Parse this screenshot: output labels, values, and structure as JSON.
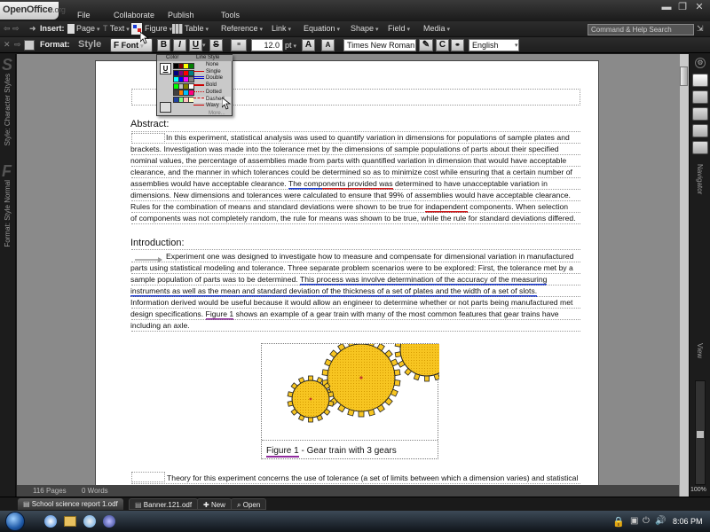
{
  "app": {
    "name": "OpenOffice",
    "name_suffix": ".org"
  },
  "menu": [
    "File",
    "Collaborate",
    "Publish",
    "Tools"
  ],
  "command_search_placeholder": "Command & Help Search",
  "toolbar_insert": {
    "label": "Insert:",
    "items": [
      "Page",
      "Text",
      "Figure",
      "Table",
      "Reference",
      "Link",
      "Equation",
      "Shape",
      "Field",
      "Media"
    ]
  },
  "toolbar_format": {
    "label": "Format:",
    "style_label": "Style",
    "font_label": "Font",
    "bold": "B",
    "italic": "I",
    "underline": "U",
    "strike": "S",
    "font_size": "12.0",
    "font_size_unit": "pt",
    "grow": "A",
    "shrink": "A",
    "font_name": "Times New Roman",
    "c_btn": "C",
    "language": "English"
  },
  "popup": {
    "color_header": "Color",
    "linestyle_header": "Line Style",
    "swatches": [
      "#000000",
      "#800000",
      "#ffff00",
      "#008000",
      "#000080",
      "#800080",
      "#ff0000",
      "#008080",
      "#00ffff",
      "#0000ff",
      "#ff00ff",
      "#808080",
      "#00ff00",
      "#c0c0c0",
      "#808000",
      "#ffffff",
      "#404040",
      "#ff8000",
      "#00c0ff",
      "#ff0080",
      "#2040a0",
      "#80ff80",
      "#ffc0c0",
      "#ffffc0"
    ],
    "styles": [
      "None",
      "Single",
      "Double",
      "Bold",
      "Dotted",
      "Dashed",
      "Wavy"
    ],
    "more": "More..."
  },
  "sidebar_left": {
    "char_styles": "Style: Character Styles",
    "format_style": "Format: Style Normal"
  },
  "sidebar_right": {
    "navigator": "Navigator",
    "view": "View",
    "zoom": "100%"
  },
  "document": {
    "abstract_heading": "Abstract:",
    "abstract_lines": [
      {
        "pre": "In this experiment, statistical analysis was used to quantify variation in dimensions for populations of sample plates and"
      },
      {
        "pre": "brackets.  Investigation was made into the tolerance met by the dimensions of sample populations of parts about their specified"
      },
      {
        "pre": "nominal values, the percentage of assemblies made from parts with quantified variation in dimension that would have acceptable"
      },
      {
        "pre": "clearance, and the manner in which tolerances could be determined so as to minimize cost while ensuring that a certain number of"
      },
      {
        "pre": "assemblies would have acceptable clearance.  ",
        "u1": "The comp",
        "u2": "onents provided was",
        "post": " determined to have unacceptable variation in"
      },
      {
        "pre": "dimensions.  New dimensions and tolerances were calculated to ensure that 99% of assemblies would have acceptable clearance."
      },
      {
        "pre": "Rules for the combination of means and standard deviations were shown to be true for ",
        "u3": "indapendent",
        "post": " components.  When selection"
      },
      {
        "pre": "of components was not completely random, the rule for means was shown to be true, while the rule for standard deviations differed."
      }
    ],
    "intro_heading": "Introduction:",
    "intro_lines": [
      {
        "pre": "Experiment one was designed to investigate how to measure and compensate for dimensional variation in manufactured"
      },
      {
        "pre": "parts using statistical modeling and tolerance.  Three separate problem scenarios were to be explored:  First, the tolerance met by a"
      },
      {
        "pre": "sample population of parts was to be determined.  ",
        "blue": "This process was involve determination of the accuracy of the measuring"
      },
      {
        "blue": "instruments as well as the mean and standard deviation of the thickness of a set of plates and the width of a set of slots."
      },
      {
        "pre": "Information derived would be useful because it would allow an engineer to determine whether or not parts being manufactured met"
      },
      {
        "pre": "design specifications.  ",
        "purp": "Figure 1",
        "post": " shows an example of a gear train with many of the most common features that gear trains have"
      },
      {
        "pre": "including an axle."
      }
    ],
    "figure_caption": "Figure 1 - Gear train with 3 gears",
    "figure_caption_prefix": "Figure 1",
    "figure_caption_rest": " - Gear train with 3 gears",
    "theory_line": "Theory for this experiment concerns the use of tolerance (a set of limits between which a dimension varies) and statistical"
  },
  "status": {
    "pages": "116 Pages",
    "words": "0 Words"
  },
  "tabs": [
    "School science report 1.odf",
    "Banner.121.odf",
    "New",
    "Open"
  ],
  "taskbar": {
    "time": "8:06 PM"
  }
}
